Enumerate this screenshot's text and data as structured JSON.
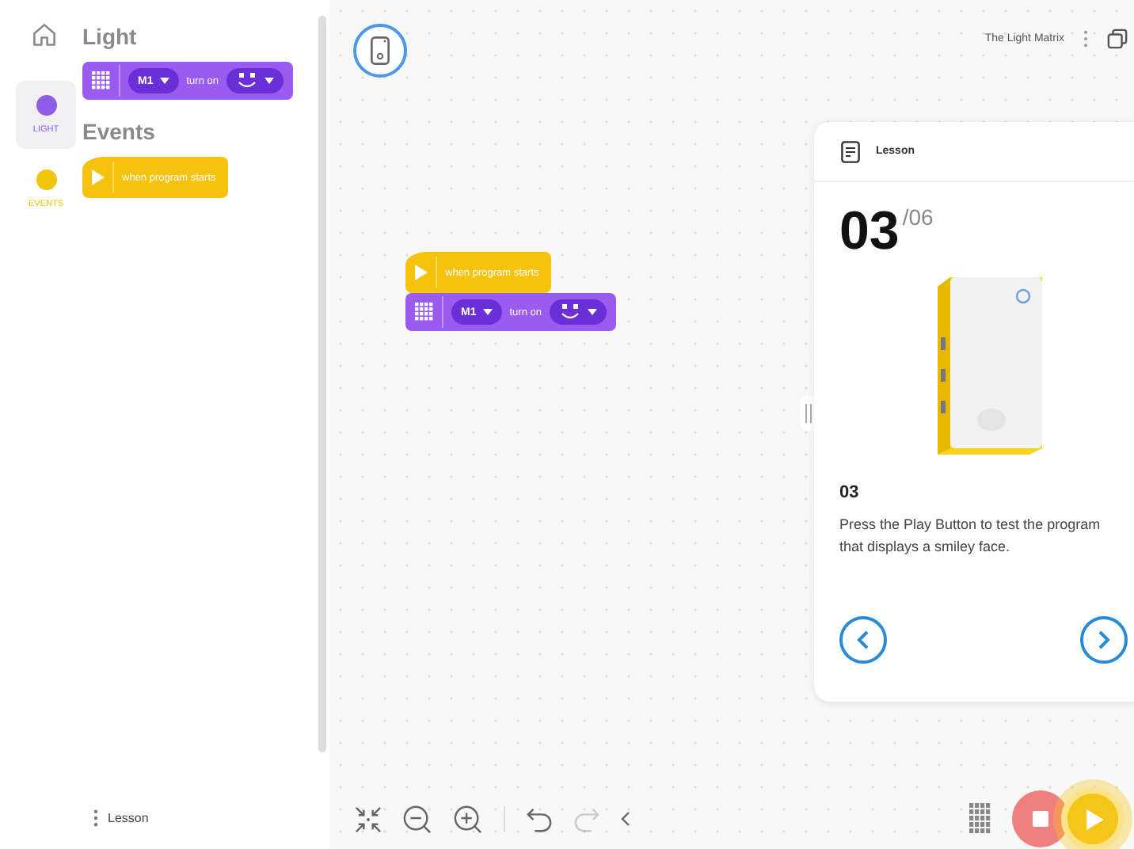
{
  "categories": [
    {
      "label": "LIGHT",
      "color": "#8f5ce8",
      "selected": true
    },
    {
      "label": "EVENTS",
      "color": "#f2c40c",
      "selected": false
    }
  ],
  "palette": [
    {
      "heading": "Light",
      "blocks": [
        {
          "kind": "light",
          "port": "M1",
          "text": "turn on"
        }
      ]
    },
    {
      "heading": "Events",
      "blocks": [
        {
          "kind": "event",
          "text": "when program starts"
        }
      ]
    }
  ],
  "sidebar_footer": {
    "label": "Lesson"
  },
  "project": {
    "title": "The Light Matrix"
  },
  "canvas_blocks": [
    {
      "kind": "event",
      "text": "when program starts"
    },
    {
      "kind": "light",
      "port": "M1",
      "text": "turn on"
    }
  ],
  "lesson": {
    "header": "Lesson",
    "step": "03",
    "total": "/06",
    "subtitle": "03",
    "text": "Press the Play Button to test the program that displays a smiley face."
  },
  "toolbar": {
    "redo_disabled": true
  }
}
